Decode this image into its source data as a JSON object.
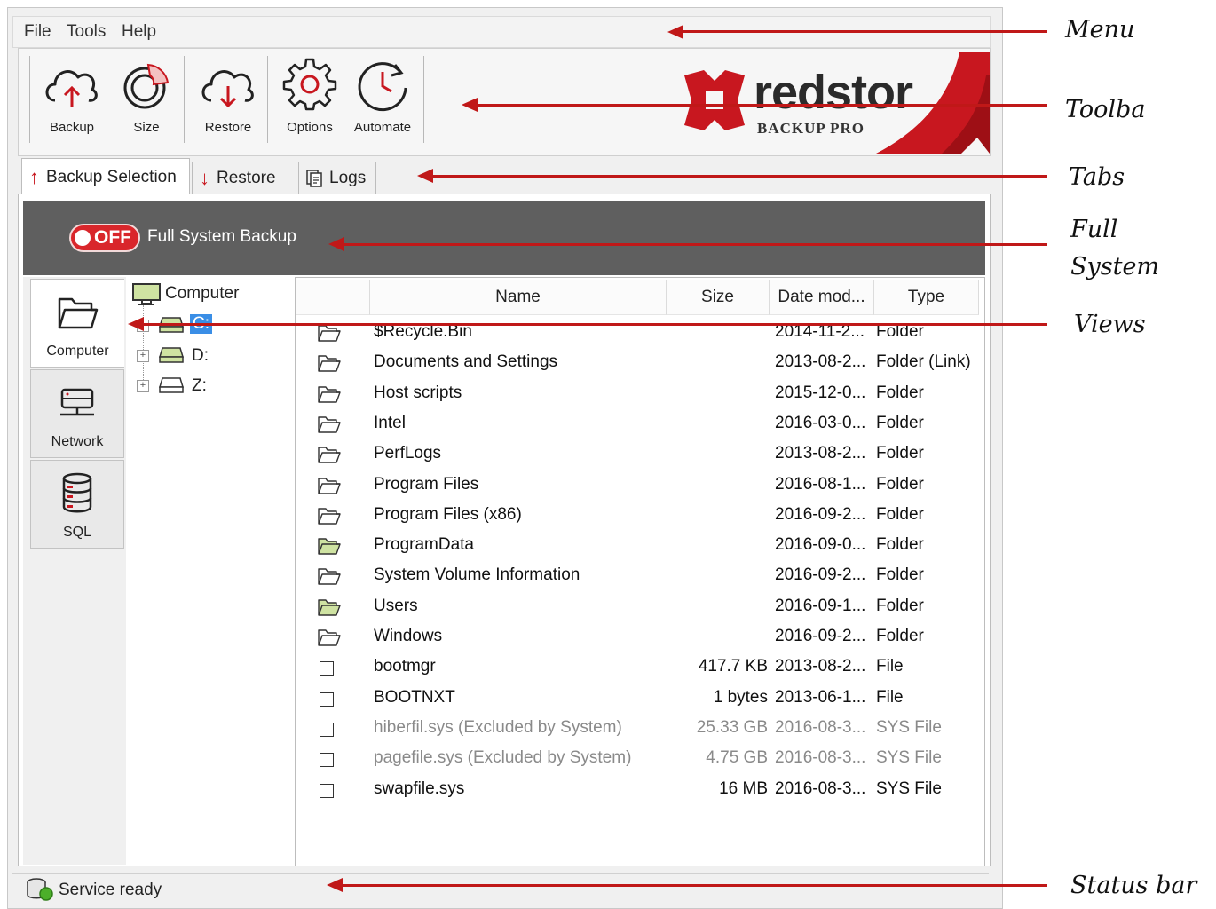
{
  "menu": {
    "items": [
      "File",
      "Tools",
      "Help"
    ]
  },
  "toolbar": {
    "buttons": [
      {
        "label": "Backup",
        "icon": "cloud-upload-icon"
      },
      {
        "label": "Size",
        "icon": "pie-chart-icon"
      },
      {
        "label": "Restore",
        "icon": "cloud-download-icon"
      },
      {
        "label": "Options",
        "icon": "gear-icon"
      },
      {
        "label": "Automate",
        "icon": "clock-icon"
      }
    ],
    "brand": {
      "name": "redstor",
      "product": "BACKUP PRO"
    }
  },
  "tabs": [
    {
      "label": "Backup Selection",
      "icon": "arrow-up-icon",
      "active": true
    },
    {
      "label": "Restore",
      "icon": "arrow-down-icon",
      "active": false
    },
    {
      "label": "Logs",
      "icon": "logs-icon",
      "active": false
    }
  ],
  "full_system_backup": {
    "toggle_state": "OFF",
    "label": "Full System Backup"
  },
  "views": [
    {
      "label": "Computer",
      "icon": "folder-icon",
      "active": true
    },
    {
      "label": "Network",
      "icon": "network-icon",
      "active": false
    },
    {
      "label": "SQL",
      "icon": "database-icon",
      "active": false
    }
  ],
  "tree": {
    "root": "Computer",
    "drives": [
      {
        "label": "C:",
        "selected": true
      },
      {
        "label": "D:",
        "selected": false
      },
      {
        "label": "Z:",
        "selected": false
      }
    ]
  },
  "file_list": {
    "columns": [
      "Name",
      "Size",
      "Date mod...",
      "Type"
    ],
    "rows": [
      {
        "name": "$Recycle.Bin",
        "size": "",
        "date": "2014-11-2...",
        "type": "Folder",
        "kind": "folder"
      },
      {
        "name": "Documents and Settings",
        "size": "",
        "date": "2013-08-2...",
        "type": "Folder (Link)",
        "kind": "folder"
      },
      {
        "name": "Host scripts",
        "size": "",
        "date": "2015-12-0...",
        "type": "Folder",
        "kind": "folder"
      },
      {
        "name": "Intel",
        "size": "",
        "date": "2016-03-0...",
        "type": "Folder",
        "kind": "folder"
      },
      {
        "name": "PerfLogs",
        "size": "",
        "date": "2013-08-2...",
        "type": "Folder",
        "kind": "folder"
      },
      {
        "name": "Program Files",
        "size": "",
        "date": "2016-08-1...",
        "type": "Folder",
        "kind": "folder"
      },
      {
        "name": "Program Files (x86)",
        "size": "",
        "date": "2016-09-2...",
        "type": "Folder",
        "kind": "folder"
      },
      {
        "name": "ProgramData",
        "size": "",
        "date": "2016-09-0...",
        "type": "Folder",
        "kind": "folder-green"
      },
      {
        "name": "System Volume Information",
        "size": "",
        "date": "2016-09-2...",
        "type": "Folder",
        "kind": "folder"
      },
      {
        "name": "Users",
        "size": "",
        "date": "2016-09-1...",
        "type": "Folder",
        "kind": "folder-green"
      },
      {
        "name": "Windows",
        "size": "",
        "date": "2016-09-2...",
        "type": "Folder",
        "kind": "folder"
      },
      {
        "name": "bootmgr",
        "size": "417.7 KB",
        "date": "2013-08-2...",
        "type": "File",
        "kind": "file"
      },
      {
        "name": "BOOTNXT",
        "size": "1 bytes",
        "date": "2013-06-1...",
        "type": "File",
        "kind": "file"
      },
      {
        "name": "hiberfil.sys (Excluded by System)",
        "size": "25.33 GB",
        "date": "2016-08-3...",
        "type": "SYS File",
        "kind": "file",
        "excluded": true
      },
      {
        "name": "pagefile.sys (Excluded by System)",
        "size": "4.75 GB",
        "date": "2016-08-3...",
        "type": "SYS File",
        "kind": "file",
        "excluded": true
      },
      {
        "name": "swapfile.sys",
        "size": "16 MB",
        "date": "2016-08-3...",
        "type": "SYS File",
        "kind": "file"
      }
    ]
  },
  "status": {
    "text": "Service ready"
  },
  "annotations": [
    {
      "label": "Menu"
    },
    {
      "label": "Toolba"
    },
    {
      "label": "Tabs"
    },
    {
      "label": "Full\nSystem"
    },
    {
      "label": "Views"
    },
    {
      "label": "Status bar"
    }
  ],
  "colors": {
    "brand_red": "#c8171f",
    "toggle_red": "#d9262b",
    "annotation_red": "#c01818",
    "bar_gray": "#5f5f5f"
  }
}
